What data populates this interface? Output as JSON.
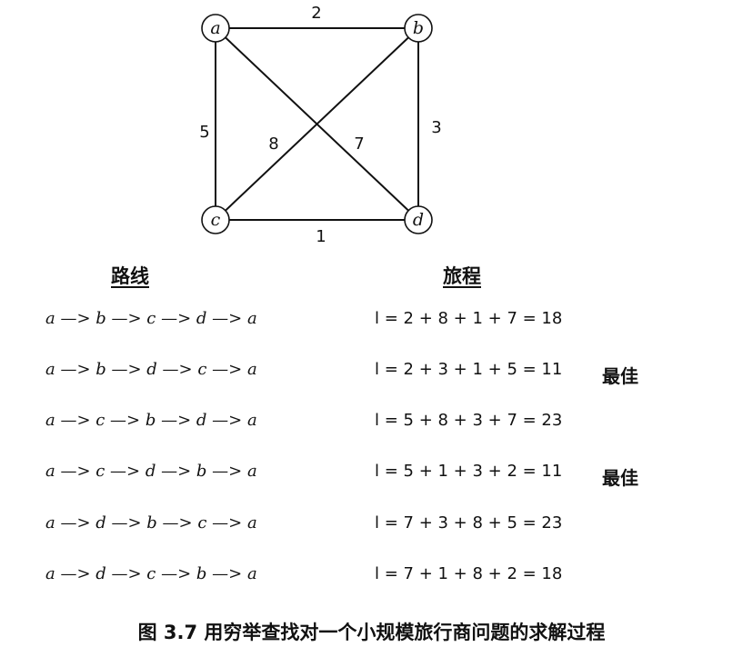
{
  "graph": {
    "nodes": [
      {
        "id": "a",
        "label": "a"
      },
      {
        "id": "b",
        "label": "b"
      },
      {
        "id": "c",
        "label": "c"
      },
      {
        "id": "d",
        "label": "d"
      }
    ],
    "edges": [
      {
        "from": "a",
        "to": "b",
        "weight": "2"
      },
      {
        "from": "b",
        "to": "d",
        "weight": "3"
      },
      {
        "from": "c",
        "to": "d",
        "weight": "1"
      },
      {
        "from": "a",
        "to": "c",
        "weight": "5"
      },
      {
        "from": "c",
        "to": "b",
        "weight": "8"
      },
      {
        "from": "a",
        "to": "d",
        "weight": "7"
      }
    ]
  },
  "table": {
    "route_header": "路线",
    "length_header": "旅程",
    "rows": [
      {
        "route": "a —> b —> c —> d —> a",
        "length": "l = 2 + 8 + 1 + 7 = 18",
        "note": ""
      },
      {
        "route": "a —> b —> d —> c —> a",
        "length": "l = 2 + 3 + 1 + 5 = 11",
        "note": "最佳"
      },
      {
        "route": "a —> c —> b —> d —> a",
        "length": "l = 5 + 8 + 3 + 7 = 23",
        "note": ""
      },
      {
        "route": "a —> c —> d —> b —> a",
        "length": "l = 5 + 1 + 3 + 2 = 11",
        "note": "最佳"
      },
      {
        "route": "a —> d —> b —> c —> a",
        "length": "l = 7 + 3 + 8 + 5 = 23",
        "note": ""
      },
      {
        "route": "a —> d —> c —> b —> a",
        "length": "l = 7 + 1 + 8 + 2 = 18",
        "note": ""
      }
    ]
  },
  "caption": "图 3.7    用穷举查找对一个小规模旅行商问题的求解过程"
}
